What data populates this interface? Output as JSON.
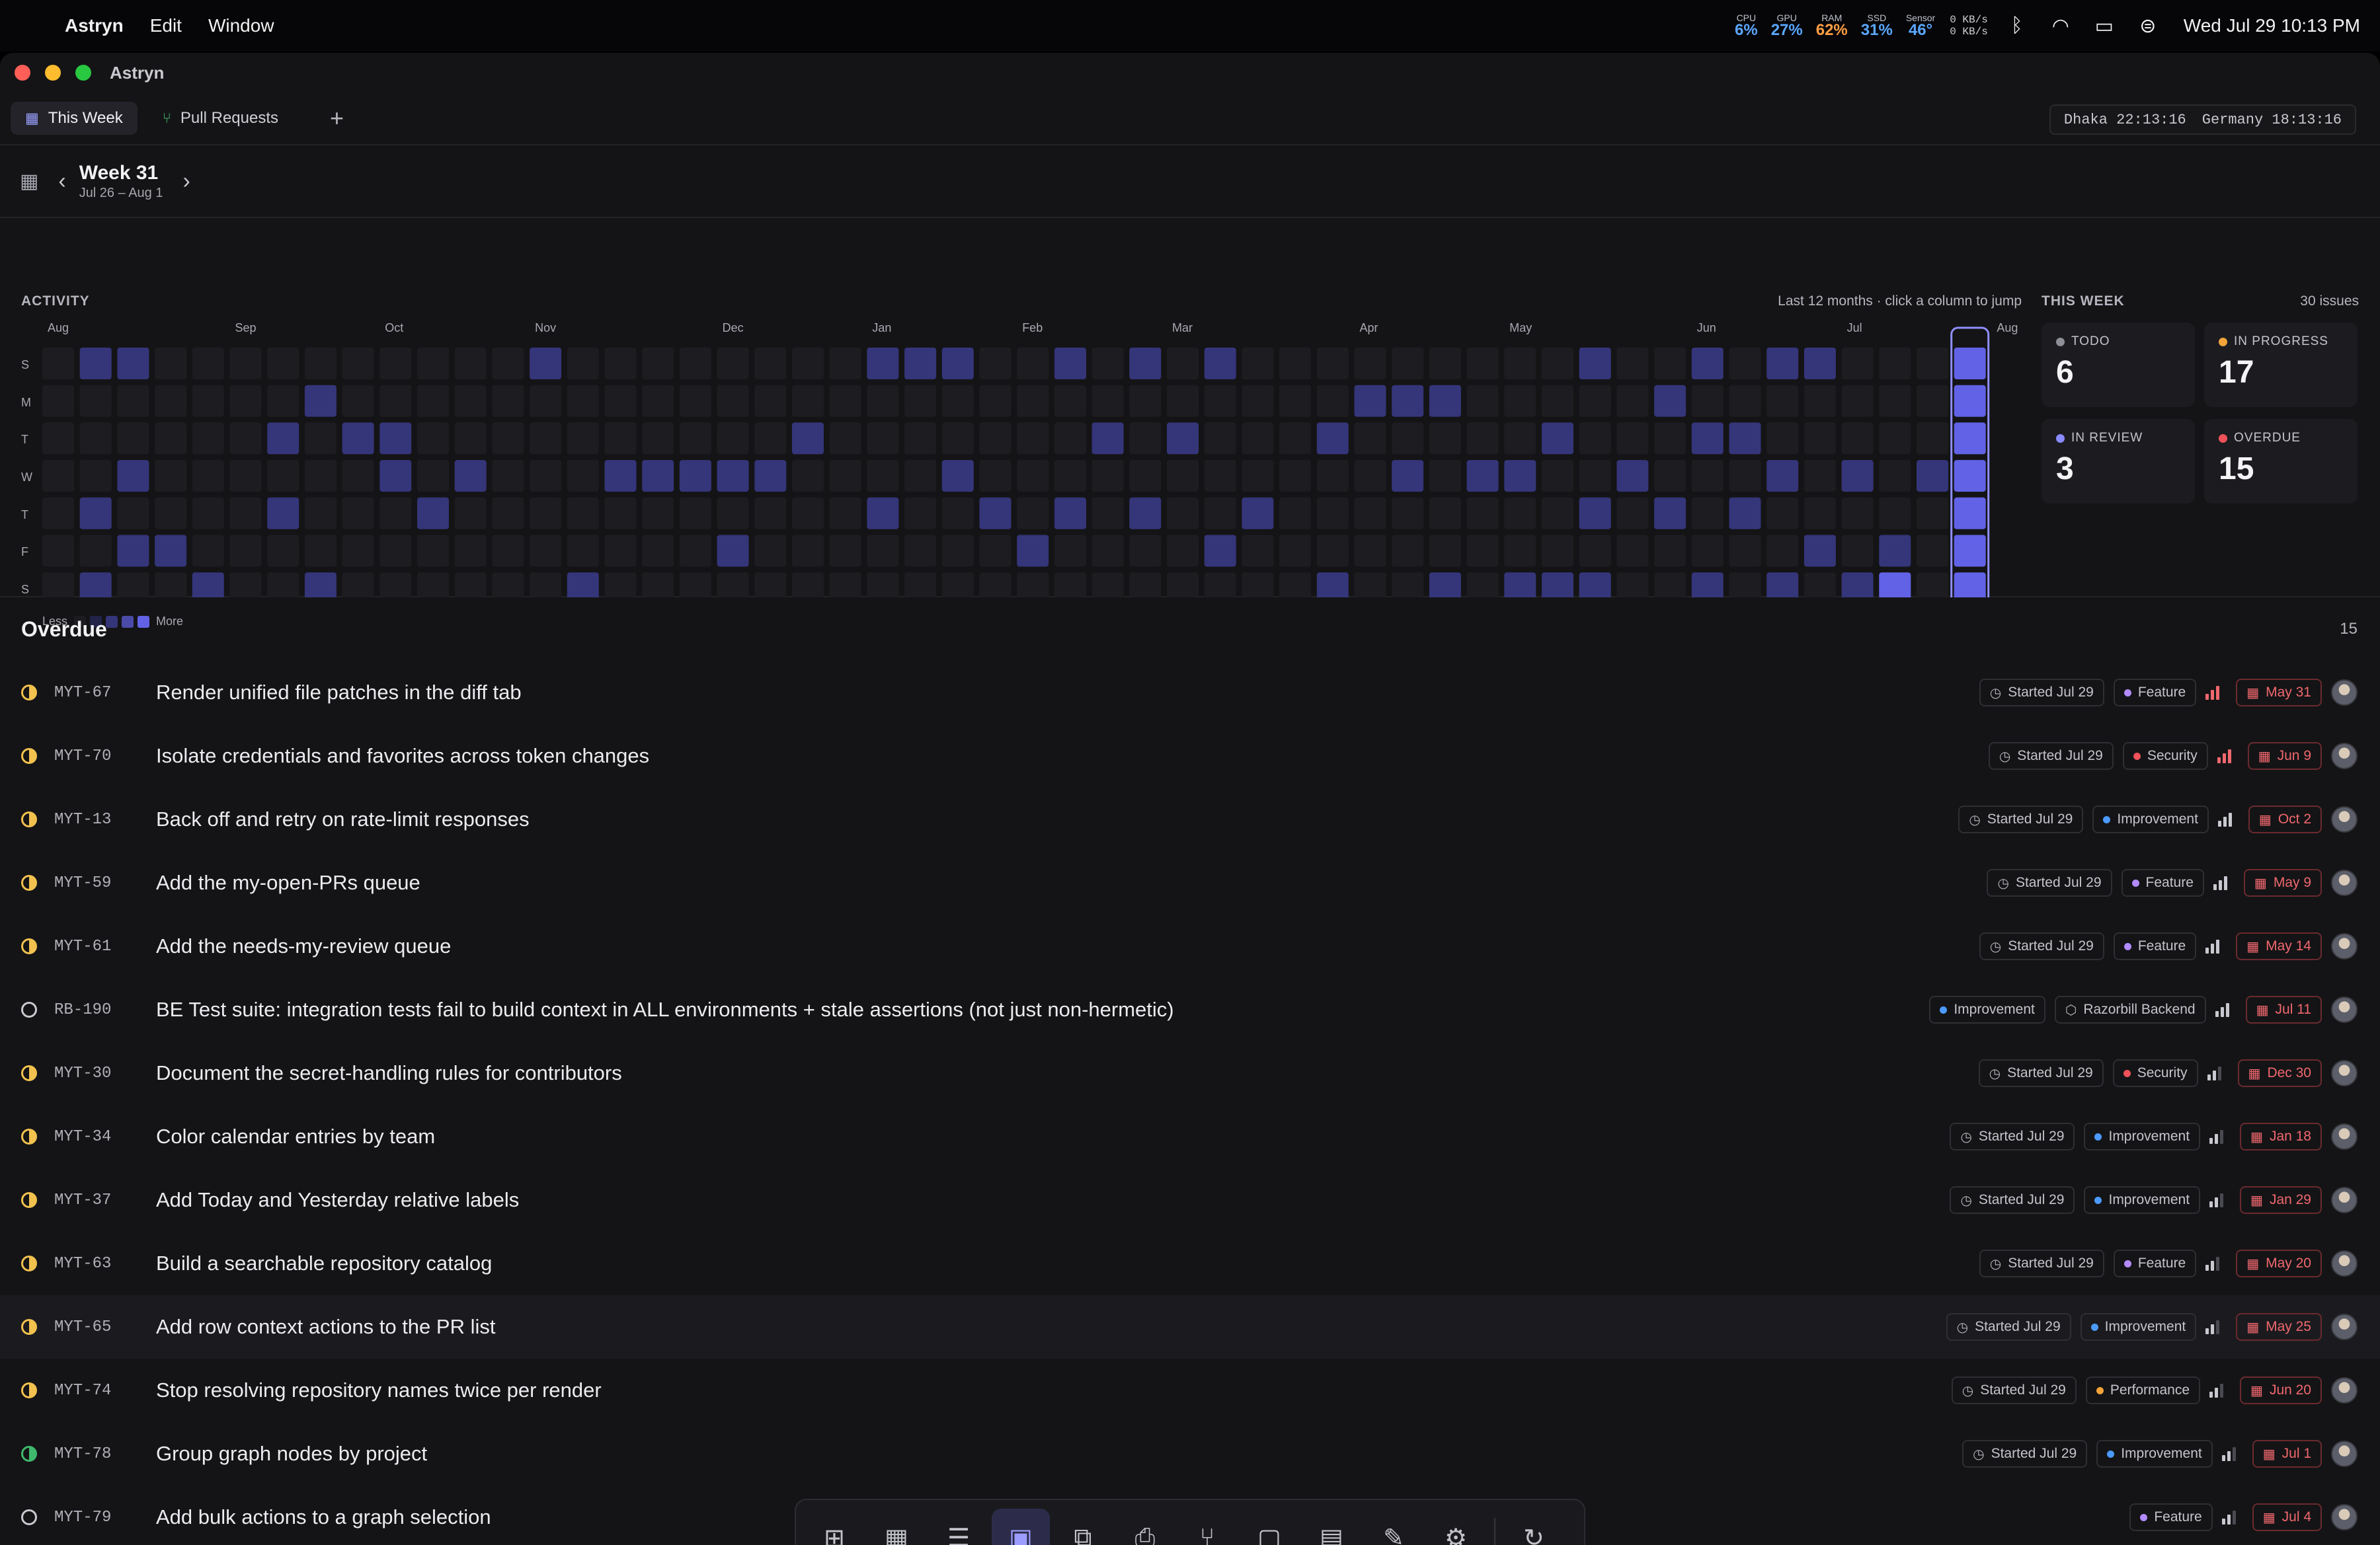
{
  "menubar": {
    "app_name": "Astryn",
    "menus": [
      "Edit",
      "Window"
    ],
    "stats": [
      {
        "label": "CPU",
        "value": "6%",
        "color": "#5aa7ff"
      },
      {
        "label": "GPU",
        "value": "27%",
        "color": "#5aa7ff"
      },
      {
        "label": "RAM",
        "value": "62%",
        "color": "#ff9f45"
      },
      {
        "label": "SSD",
        "value": "31%",
        "color": "#5aa7ff"
      },
      {
        "label": "Sensor",
        "value": "46°",
        "color": "#5aa7ff"
      }
    ],
    "net_up": "0 KB/s",
    "net_down": "0 KB/s",
    "clock": "Wed Jul 29  10:13 PM"
  },
  "window": {
    "title": "Astryn",
    "tabs": [
      {
        "label": "This Week",
        "icon": "calendar-icon",
        "active": true
      },
      {
        "label": "Pull Requests",
        "icon": "git-pull-request-icon",
        "active": false
      }
    ],
    "timezones": [
      "Dhaka 22:13:16",
      "Germany 18:13:16"
    ]
  },
  "week": {
    "title": "Week 31",
    "range": "Jul 26 – Aug 1"
  },
  "activity": {
    "title": "ACTIVITY",
    "hint": "Last 12 months · click a column to jump",
    "months": [
      {
        "label": "Aug",
        "col": 0
      },
      {
        "label": "Sep",
        "col": 5
      },
      {
        "label": "Oct",
        "col": 9
      },
      {
        "label": "Nov",
        "col": 13
      },
      {
        "label": "Dec",
        "col": 18
      },
      {
        "label": "Jan",
        "col": 22
      },
      {
        "label": "Feb",
        "col": 26
      },
      {
        "label": "Mar",
        "col": 30
      },
      {
        "label": "Apr",
        "col": 35
      },
      {
        "label": "May",
        "col": 39
      },
      {
        "label": "Jun",
        "col": 44
      },
      {
        "label": "Jul",
        "col": 48
      },
      {
        "label": "Aug",
        "col": 52
      }
    ],
    "days": [
      "S",
      "M",
      "T",
      "W",
      "T",
      "F",
      "S"
    ],
    "legend": {
      "less": "Less",
      "more": "More"
    },
    "levels_colors": [
      "#1d1d21",
      "#23234a",
      "#35357a",
      "#4a4aa8",
      "#6262e6"
    ],
    "selected_week": 51,
    "cells": [
      [
        1,
        0,
        2,
        0
      ],
      [
        1,
        0,
        2
      ],
      [
        1,
        6,
        2
      ],
      [
        1,
        2,
        0
      ],
      [
        1,
        4,
        2
      ],
      [
        2,
        0,
        2
      ],
      [
        2,
        3,
        2
      ],
      [
        2,
        5,
        2
      ],
      [
        3,
        5,
        2
      ],
      [
        4,
        6,
        2
      ],
      [
        6,
        2,
        2
      ],
      [
        6,
        4,
        2
      ],
      [
        7,
        1,
        2
      ],
      [
        7,
        6,
        2
      ],
      [
        8,
        2,
        2
      ],
      [
        9,
        2,
        2
      ],
      [
        9,
        3,
        2
      ],
      [
        10,
        4,
        2
      ],
      [
        11,
        3,
        2
      ],
      [
        13,
        0,
        2
      ],
      [
        12,
        1,
        0
      ],
      [
        14,
        6,
        2
      ],
      [
        15,
        3,
        2
      ],
      [
        16,
        3,
        2
      ],
      [
        17,
        3,
        2
      ],
      [
        18,
        3,
        2
      ],
      [
        18,
        5,
        2
      ],
      [
        19,
        3,
        2
      ],
      [
        20,
        2,
        2
      ],
      [
        22,
        0,
        2
      ],
      [
        22,
        4,
        2
      ],
      [
        23,
        0,
        2
      ],
      [
        24,
        0,
        2
      ],
      [
        24,
        3,
        2
      ],
      [
        25,
        4,
        2
      ],
      [
        26,
        5,
        2
      ],
      [
        27,
        0,
        2
      ],
      [
        27,
        4,
        2
      ],
      [
        28,
        2,
        2
      ],
      [
        29,
        0,
        2
      ],
      [
        29,
        4,
        2
      ],
      [
        30,
        2,
        2
      ],
      [
        31,
        0,
        2
      ],
      [
        31,
        5,
        2
      ],
      [
        32,
        4,
        2
      ],
      [
        34,
        2,
        2
      ],
      [
        34,
        6,
        2
      ],
      [
        35,
        1,
        2
      ],
      [
        36,
        1,
        2
      ],
      [
        36,
        3,
        2
      ],
      [
        37,
        1,
        2
      ],
      [
        37,
        6,
        2
      ],
      [
        38,
        3,
        2
      ],
      [
        39,
        3,
        2
      ],
      [
        39,
        6,
        2
      ],
      [
        40,
        2,
        2
      ],
      [
        40,
        6,
        2
      ],
      [
        41,
        0,
        2
      ],
      [
        41,
        4,
        2
      ],
      [
        41,
        6,
        2
      ],
      [
        42,
        3,
        2
      ],
      [
        43,
        1,
        2
      ],
      [
        43,
        4,
        2
      ],
      [
        44,
        0,
        2
      ],
      [
        44,
        2,
        2
      ],
      [
        44,
        6,
        2
      ],
      [
        45,
        2,
        2
      ],
      [
        45,
        4,
        2
      ],
      [
        46,
        0,
        2
      ],
      [
        46,
        3,
        2
      ],
      [
        46,
        6,
        2
      ],
      [
        47,
        0,
        2
      ],
      [
        47,
        5,
        2
      ],
      [
        48,
        3,
        2
      ],
      [
        48,
        6,
        2
      ],
      [
        49,
        5,
        2
      ],
      [
        49,
        6,
        4
      ],
      [
        50,
        3,
        2
      ],
      [
        51,
        0,
        2
      ]
    ]
  },
  "this_week": {
    "title": "THIS WEEK",
    "count": "30 issues",
    "stats": [
      {
        "label": "TODO",
        "value": "6",
        "color": "#8e8e96"
      },
      {
        "label": "IN PROGRESS",
        "value": "17",
        "color": "#f2a43a"
      },
      {
        "label": "IN REVIEW",
        "value": "3",
        "color": "#8a8aff"
      },
      {
        "label": "OVERDUE",
        "value": "15",
        "color": "#f0525a"
      }
    ]
  },
  "overdue": {
    "title": "Overdue",
    "count": "15",
    "issues": [
      {
        "status": "half",
        "id": "MYT-67",
        "title": "Render unified file patches in the diff tab",
        "started": "Started Jul 29",
        "label": "Feature",
        "label_color": "#b28bff",
        "priority": "urgent",
        "bars": 3,
        "due": "May 31"
      },
      {
        "status": "half",
        "id": "MYT-70",
        "title": "Isolate credentials and favorites across token changes",
        "started": "Started Jul 29",
        "label": "Security",
        "label_color": "#f0525a",
        "priority": "urgent",
        "bars": 3,
        "due": "Jun 9"
      },
      {
        "status": "half",
        "id": "MYT-13",
        "title": "Back off and retry on rate-limit responses",
        "started": "Started Jul 29",
        "label": "Improvement",
        "label_color": "#4c9aff",
        "priority": "high",
        "bars": 3,
        "due": "Oct 2"
      },
      {
        "status": "half",
        "id": "MYT-59",
        "title": "Add the my-open-PRs queue",
        "started": "Started Jul 29",
        "label": "Feature",
        "label_color": "#b28bff",
        "priority": "high",
        "bars": 3,
        "due": "May 9"
      },
      {
        "status": "half",
        "id": "MYT-61",
        "title": "Add the needs-my-review queue",
        "started": "Started Jul 29",
        "label": "Feature",
        "label_color": "#b28bff",
        "priority": "high",
        "bars": 3,
        "due": "May 14"
      },
      {
        "status": "empty",
        "id": "RB-190",
        "title": "BE Test suite: integration tests fail to build context in ALL environments + stale assertions (not just non-hermetic)",
        "started": "",
        "label": "Improvement",
        "label_color": "#4c9aff",
        "project": "Razorbill Backend",
        "priority": "high",
        "bars": 3,
        "due": "Jul 11"
      },
      {
        "status": "half",
        "id": "MYT-30",
        "title": "Document the secret-handling rules for contributors",
        "started": "Started Jul 29",
        "label": "Security",
        "label_color": "#f0525a",
        "priority": "medium",
        "bars": 2,
        "due": "Dec 30"
      },
      {
        "status": "half",
        "id": "MYT-34",
        "title": "Color calendar entries by team",
        "started": "Started Jul 29",
        "label": "Improvement",
        "label_color": "#4c9aff",
        "priority": "medium",
        "bars": 2,
        "due": "Jan 18"
      },
      {
        "status": "half",
        "id": "MYT-37",
        "title": "Add Today and Yesterday relative labels",
        "started": "Started Jul 29",
        "label": "Improvement",
        "label_color": "#4c9aff",
        "priority": "medium",
        "bars": 2,
        "due": "Jan 29"
      },
      {
        "status": "half",
        "id": "MYT-63",
        "title": "Build a searchable repository catalog",
        "started": "Started Jul 29",
        "label": "Feature",
        "label_color": "#b28bff",
        "priority": "medium",
        "bars": 2,
        "due": "May 20"
      },
      {
        "status": "half",
        "id": "MYT-65",
        "title": "Add row context actions to the PR list",
        "started": "Started Jul 29",
        "label": "Improvement",
        "label_color": "#4c9aff",
        "priority": "medium",
        "bars": 2,
        "due": "May 25",
        "hover": true
      },
      {
        "status": "half",
        "id": "MYT-74",
        "title": "Stop resolving repository names twice per render",
        "started": "Started Jul 29",
        "label": "Performance",
        "label_color": "#f2a43a",
        "priority": "medium",
        "bars": 2,
        "due": "Jun 20"
      },
      {
        "status": "green",
        "id": "MYT-78",
        "title": "Group graph nodes by project",
        "started": "Started Jul 29",
        "label": "Improvement",
        "label_color": "#4c9aff",
        "priority": "medium",
        "bars": 2,
        "due": "Jul 1"
      },
      {
        "status": "empty",
        "id": "MYT-79",
        "title": "Add bulk actions to a graph selection",
        "started": "",
        "label": "Feature",
        "label_color": "#b28bff",
        "priority": "medium",
        "bars": 2,
        "due": "Jul 4"
      }
    ]
  },
  "dock": {
    "items": [
      {
        "icon": "dashboard-icon",
        "glyph": "⊞"
      },
      {
        "icon": "calendar-icon",
        "glyph": "▦"
      },
      {
        "icon": "list-icon",
        "glyph": "☰"
      },
      {
        "icon": "this-week-icon",
        "glyph": "▣",
        "active": true
      },
      {
        "icon": "hierarchy-icon",
        "glyph": "⧉"
      },
      {
        "icon": "inbox-icon",
        "glyph": "⎙"
      },
      {
        "icon": "pull-request-icon",
        "glyph": "⑂"
      },
      {
        "icon": "chat-icon",
        "glyph": "▢"
      },
      {
        "icon": "document-icon",
        "glyph": "▤"
      },
      {
        "icon": "edit-icon",
        "glyph": "✎"
      },
      {
        "icon": "settings-icon",
        "glyph": "⚙"
      },
      {
        "icon": "refresh-icon",
        "glyph": "↻",
        "separator": true
      }
    ]
  }
}
